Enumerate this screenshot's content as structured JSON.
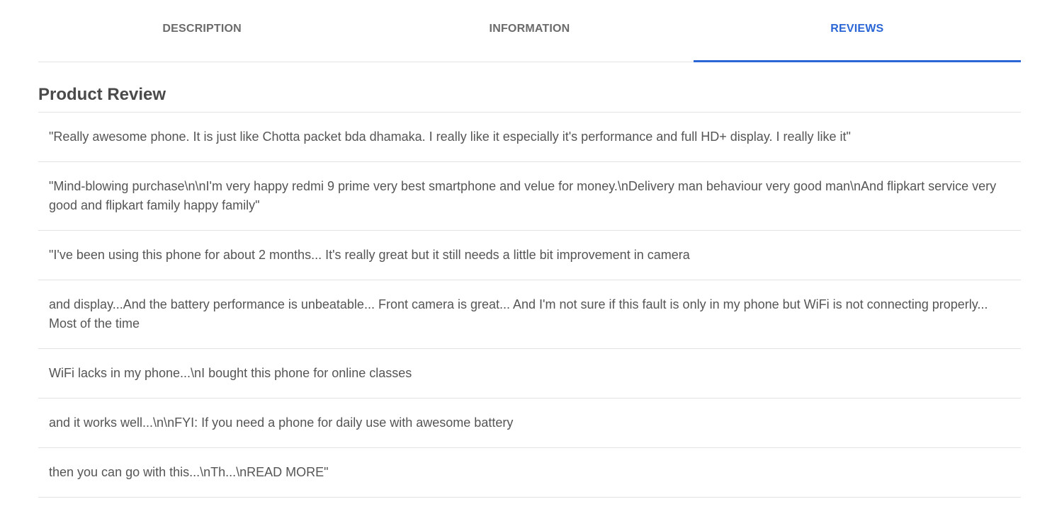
{
  "tabs": [
    {
      "label": "DESCRIPTION",
      "active": false
    },
    {
      "label": "INFORMATION",
      "active": false
    },
    {
      "label": "REVIEWS",
      "active": true
    }
  ],
  "review": {
    "title": "Product Review",
    "items": [
      "\"Really awesome phone. It is just like Chotta packet bda dhamaka. I really like it especially it's performance and full HD+ display. I really like it\"",
      "\"Mind-blowing purchase\\n\\nI'm very happy redmi 9 prime very best smartphone and velue for money.\\nDelivery man behaviour very good man\\nAnd flipkart service very good and flipkart family happy family\"",
      "\"I've been using this phone for about 2 months... It's really great but it still needs a little bit improvement in camera",
      "and display...And the battery performance is unbeatable... Front camera is great... And I'm not sure if this fault is only in my phone but WiFi is not connecting properly... Most of the time",
      "WiFi lacks in my phone...\\nI bought this phone for online classes",
      "and it works well...\\n\\nFYI: If you need a phone for daily use with awesome battery",
      "then you can go with this...\\nTh...\\nREAD MORE\""
    ]
  },
  "colors": {
    "accent": "#2a66d6",
    "text": "#555555",
    "divider": "#e3e3e3"
  }
}
